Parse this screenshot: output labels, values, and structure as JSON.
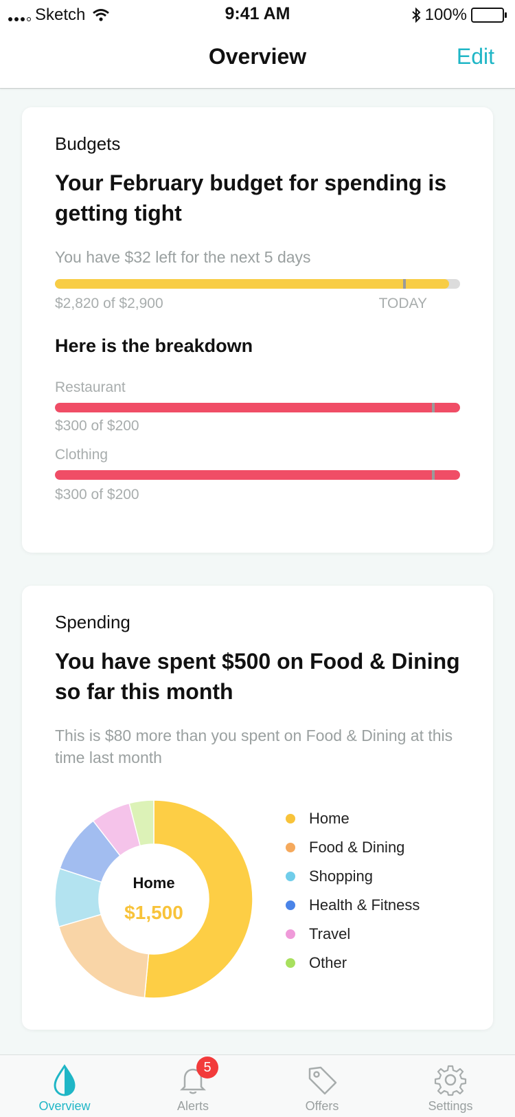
{
  "status_bar": {
    "carrier": "Sketch",
    "time": "9:41 AM",
    "battery": "100%"
  },
  "nav": {
    "title": "Overview",
    "edit_label": "Edit"
  },
  "budgets": {
    "section_label": "Budgets",
    "headline": "Your February budget for spending is getting tight",
    "subtitle": "You have $32 left for the next 5 days",
    "overall": {
      "spent_text": "$2,820 of $2,900",
      "today_label": "TODAY",
      "fill_fraction": 0.9724,
      "today_fraction": 0.86,
      "color": "#f8cd45"
    },
    "breakdown_title": "Here is the breakdown",
    "categories": [
      {
        "name": "Restaurant",
        "amount_text": "$300 of $200",
        "fill_fraction": 1.0,
        "marker_fraction": 0.93,
        "color": "#f04d66"
      },
      {
        "name": "Clothing",
        "amount_text": "$300 of $200",
        "fill_fraction": 1.0,
        "marker_fraction": 0.93,
        "color": "#f04d66"
      }
    ]
  },
  "spending": {
    "section_label": "Spending",
    "headline": "You have spent $500 on Food & Dining so far this month",
    "subtitle": "This is $80 more than you spent on Food & Dining at this time last month",
    "donut_center_label": "Home",
    "donut_center_value": "$1,500",
    "legend": [
      {
        "label": "Home",
        "color": "#f8c33a"
      },
      {
        "label": "Food & Dining",
        "color": "#f5a95c"
      },
      {
        "label": "Shopping",
        "color": "#70cdea"
      },
      {
        "label": "Health & Fitness",
        "color": "#4a84e8"
      },
      {
        "label": "Travel",
        "color": "#ef9ad9"
      },
      {
        "label": "Other",
        "color": "#a8e05e"
      }
    ]
  },
  "chart_data": {
    "type": "pie",
    "categories": [
      "Home",
      "Food & Dining",
      "Shopping",
      "Health & Fitness",
      "Travel",
      "Other"
    ],
    "values": [
      51.5,
      19,
      9.5,
      9.5,
      6.5,
      4
    ],
    "colors": [
      "#fdce45",
      "#f9d5a7",
      "#b3e3f0",
      "#a2bdf0",
      "#f5c3ea",
      "#dcf2b7"
    ]
  },
  "tabbar": {
    "tabs": [
      {
        "label": "Overview",
        "active": true
      },
      {
        "label": "Alerts",
        "badge": "5"
      },
      {
        "label": "Offers"
      },
      {
        "label": "Settings"
      }
    ]
  }
}
